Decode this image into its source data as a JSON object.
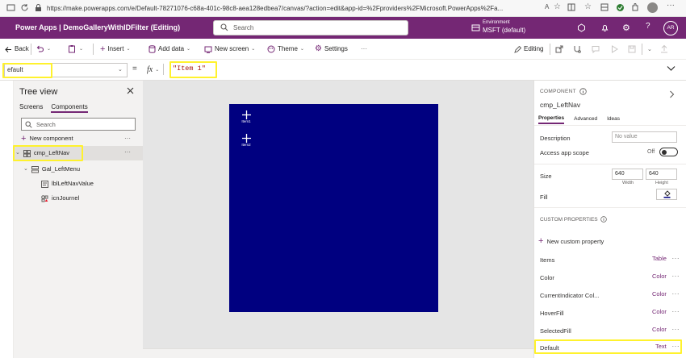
{
  "browser": {
    "url": "https://make.powerapps.com/e/Default-78271076-c68a-401c-98c8-aea128edbea7/canvas/?action=edit&app-id=%2Fproviders%2FMicrosoft.PowerApps%2Fa..."
  },
  "header": {
    "app_title": "Power Apps  |  DemoGalleryWithIDFilter (Editing)",
    "search_placeholder": "Search",
    "env_label": "Environment",
    "env_name": "MSFT (default)",
    "avatar": "AR",
    "color": "#742774"
  },
  "commands": {
    "back": "Back",
    "insert": "Insert",
    "add_data": "Add data",
    "new_screen": "New screen",
    "theme": "Theme",
    "settings": "Settings",
    "more": "···",
    "editing": "Editing"
  },
  "formula_bar": {
    "property": "efault",
    "equals": "=",
    "fx": "fx",
    "formula": "\"Item 1\""
  },
  "tree": {
    "title": "Tree view",
    "tabs": [
      "Screens",
      "Components"
    ],
    "search_placeholder": "Search",
    "new_component": "New component",
    "nodes": [
      "cmp_LeftNav",
      "Gal_LeftMenu",
      "lblLeftNavValue",
      "icnJournel"
    ]
  },
  "canvas": {
    "component_color": "#000080",
    "items": [
      "Item1",
      "Item2"
    ]
  },
  "properties": {
    "section": "COMPONENT",
    "name": "cmp_LeftNav",
    "tabs": [
      "Properties",
      "Advanced",
      "Ideas"
    ],
    "description_label": "Description",
    "description_placeholder": "No value",
    "scope_label": "Access app scope",
    "scope_value": "Off",
    "size_label": "Size",
    "width": "640",
    "height": "640",
    "width_label": "Width",
    "height_label": "Height",
    "fill_label": "Fill",
    "custom_header": "CUSTOM PROPERTIES",
    "new_custom": "New custom property",
    "custom": [
      {
        "name": "Items",
        "type": "Table"
      },
      {
        "name": "Color",
        "type": "Color"
      },
      {
        "name": "CurrentIndicator Col...",
        "type": "Color"
      },
      {
        "name": "HoverFill",
        "type": "Color"
      },
      {
        "name": "SelectedFill",
        "type": "Color"
      },
      {
        "name": "Default",
        "type": "Text"
      }
    ],
    "dots": "···"
  }
}
